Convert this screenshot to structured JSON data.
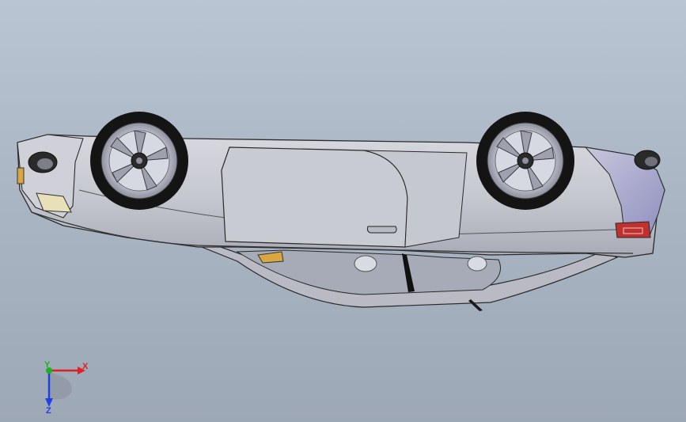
{
  "viewport": {
    "background_top": "#b9c5d3",
    "background_bottom": "#9da8b6"
  },
  "model": {
    "body_color": "#c9cbd3",
    "body_shade": "#a9acb6",
    "tire_color": "#141414",
    "rim_color": "#c8cbd6",
    "taillight_color": "#c0302f",
    "indicator_color": "#d9a640"
  },
  "triad": {
    "x_label": "X",
    "y_label": "Y",
    "z_label": "Z",
    "x_color": "#e02020",
    "y_color": "#20b020",
    "z_color": "#2040e0"
  }
}
